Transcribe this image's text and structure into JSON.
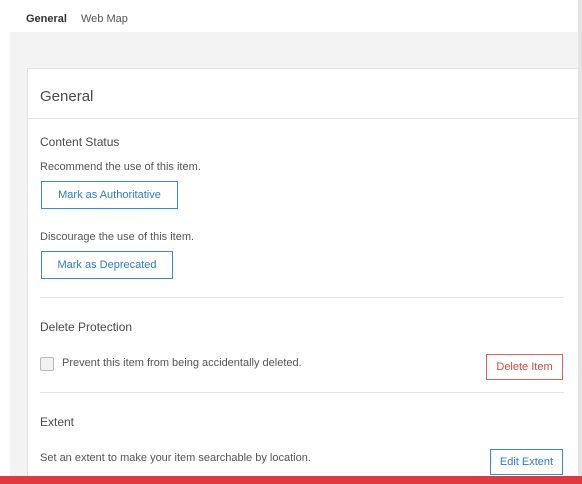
{
  "tabs": [
    {
      "label": "General",
      "active": true
    },
    {
      "label": "Web Map",
      "active": false
    }
  ],
  "card": {
    "title": "General",
    "content_status": {
      "heading": "Content Status",
      "recommend_text": "Recommend the use of this item.",
      "authoritative_button": "Mark as Authoritative",
      "discourage_text": "Discourage the use of this item.",
      "deprecated_button": "Mark as Deprecated"
    },
    "delete_protection": {
      "heading": "Delete Protection",
      "checkbox_label": "Prevent this item from being accidentally deleted.",
      "checked": false,
      "delete_button": "Delete Item"
    },
    "extent": {
      "heading": "Extent",
      "text": "Set an extent to make your item searchable by location.",
      "edit_button": "Edit Extent"
    }
  },
  "colors": {
    "accent_blue": "#2f7dbf",
    "danger_red": "#d0493d",
    "bottom_bar": "#e1373f",
    "background_grey": "#f3f3f3"
  }
}
